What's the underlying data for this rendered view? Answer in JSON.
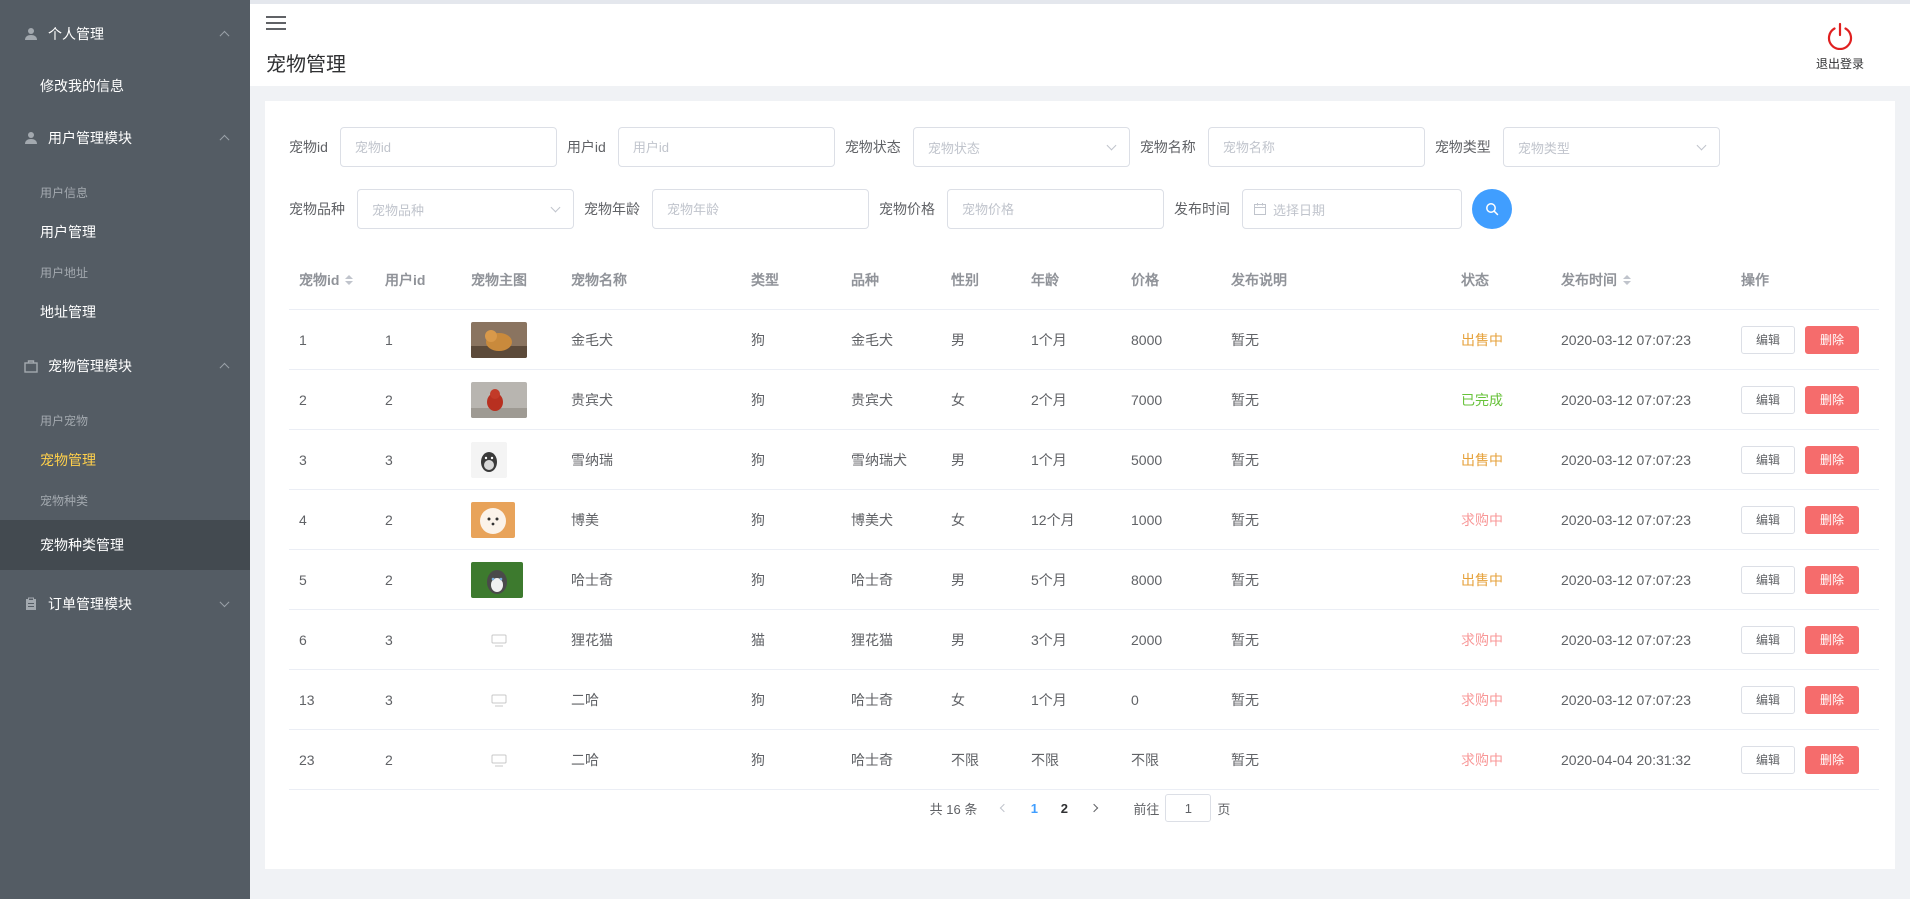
{
  "sidebar": {
    "groups": [
      {
        "label": "个人管理",
        "icon": "user-icon",
        "items": [
          {
            "label": "修改我的信息",
            "state": "normal"
          }
        ]
      },
      {
        "label": "用户管理模块",
        "icon": "user-icon",
        "items": [
          {
            "label": "用户信息",
            "state": "muted"
          },
          {
            "label": "用户管理",
            "state": "normal"
          },
          {
            "label": "用户地址",
            "state": "muted"
          },
          {
            "label": "地址管理",
            "state": "normal"
          }
        ]
      },
      {
        "label": "宠物管理模块",
        "icon": "bag-icon",
        "items": [
          {
            "label": "用户宠物",
            "state": "muted"
          },
          {
            "label": "宠物管理",
            "state": "active"
          },
          {
            "label": "宠物种类",
            "state": "muted"
          },
          {
            "label": "宠物种类管理",
            "state": "selected"
          }
        ]
      },
      {
        "label": "订单管理模块",
        "icon": "clipboard-icon",
        "items": []
      }
    ]
  },
  "header": {
    "title": "宠物管理",
    "logout_label": "退出登录"
  },
  "filters": {
    "pet_id": {
      "label": "宠物id",
      "placeholder": "宠物id"
    },
    "user_id": {
      "label": "用户id",
      "placeholder": "用户id"
    },
    "status": {
      "label": "宠物状态",
      "placeholder": "宠物状态"
    },
    "name": {
      "label": "宠物名称",
      "placeholder": "宠物名称"
    },
    "type": {
      "label": "宠物类型",
      "placeholder": "宠物类型"
    },
    "breed": {
      "label": "宠物品种",
      "placeholder": "宠物品种"
    },
    "age": {
      "label": "宠物年龄",
      "placeholder": "宠物年龄"
    },
    "price": {
      "label": "宠物价格",
      "placeholder": "宠物价格"
    },
    "date": {
      "label": "发布时间",
      "placeholder": "选择日期"
    }
  },
  "table": {
    "columns": [
      "宠物id",
      "用户id",
      "宠物主图",
      "宠物名称",
      "类型",
      "品种",
      "性别",
      "年龄",
      "价格",
      "发布说明",
      "状态",
      "发布时间",
      "操作"
    ],
    "edit_label": "编辑",
    "delete_label": "删除",
    "rows": [
      {
        "id": "1",
        "uid": "1",
        "img": "golden",
        "name": "金毛犬",
        "type": "狗",
        "breed": "金毛犬",
        "sex": "男",
        "age": "1个月",
        "price": "8000",
        "desc": "暂无",
        "status": "出售中",
        "status_kind": "sale",
        "time": "2020-03-12 07:07:23"
      },
      {
        "id": "2",
        "uid": "2",
        "img": "poodle",
        "name": "贵宾犬",
        "type": "狗",
        "breed": "贵宾犬",
        "sex": "女",
        "age": "2个月",
        "price": "7000",
        "desc": "暂无",
        "status": "已完成",
        "status_kind": "done",
        "time": "2020-03-12 07:07:23"
      },
      {
        "id": "3",
        "uid": "3",
        "img": "schnauzer",
        "name": "雪纳瑞",
        "type": "狗",
        "breed": "雪纳瑞犬",
        "sex": "男",
        "age": "1个月",
        "price": "5000",
        "desc": "暂无",
        "status": "出售中",
        "status_kind": "sale",
        "time": "2020-03-12 07:07:23"
      },
      {
        "id": "4",
        "uid": "2",
        "img": "pomeranian",
        "name": "博美",
        "type": "狗",
        "breed": "博美犬",
        "sex": "女",
        "age": "12个月",
        "price": "1000",
        "desc": "暂无",
        "status": "求购中",
        "status_kind": "buy",
        "time": "2020-03-12 07:07:23"
      },
      {
        "id": "5",
        "uid": "2",
        "img": "husky",
        "name": "哈士奇",
        "type": "狗",
        "breed": "哈士奇",
        "sex": "男",
        "age": "5个月",
        "price": "8000",
        "desc": "暂无",
        "status": "出售中",
        "status_kind": "sale",
        "time": "2020-03-12 07:07:23"
      },
      {
        "id": "6",
        "uid": "3",
        "img": "placeholder",
        "name": "狸花猫",
        "type": "猫",
        "breed": "狸花猫",
        "sex": "男",
        "age": "3个月",
        "price": "2000",
        "desc": "暂无",
        "status": "求购中",
        "status_kind": "buy",
        "time": "2020-03-12 07:07:23"
      },
      {
        "id": "13",
        "uid": "3",
        "img": "placeholder",
        "name": "二哈",
        "type": "狗",
        "breed": "哈士奇",
        "sex": "女",
        "age": "1个月",
        "price": "0",
        "desc": "暂无",
        "status": "求购中",
        "status_kind": "buy",
        "time": "2020-03-12 07:07:23"
      },
      {
        "id": "23",
        "uid": "2",
        "img": "placeholder",
        "name": "二哈",
        "type": "狗",
        "breed": "哈士奇",
        "sex": "不限",
        "age": "不限",
        "price": "不限",
        "desc": "暂无",
        "status": "求购中",
        "status_kind": "buy",
        "time": "2020-04-04 20:31:32"
      }
    ]
  },
  "pagination": {
    "total": "共 16 条",
    "pages": [
      "1",
      "2"
    ],
    "current": "1",
    "goto_prefix": "前往",
    "goto_value": "1",
    "goto_suffix": "页"
  },
  "colors": {
    "sidebar_bg": "#545c64",
    "active": "#ffd04b",
    "primary": "#409eff",
    "danger": "#f56c6c",
    "warning": "#e6a23c",
    "success": "#67c23a"
  }
}
